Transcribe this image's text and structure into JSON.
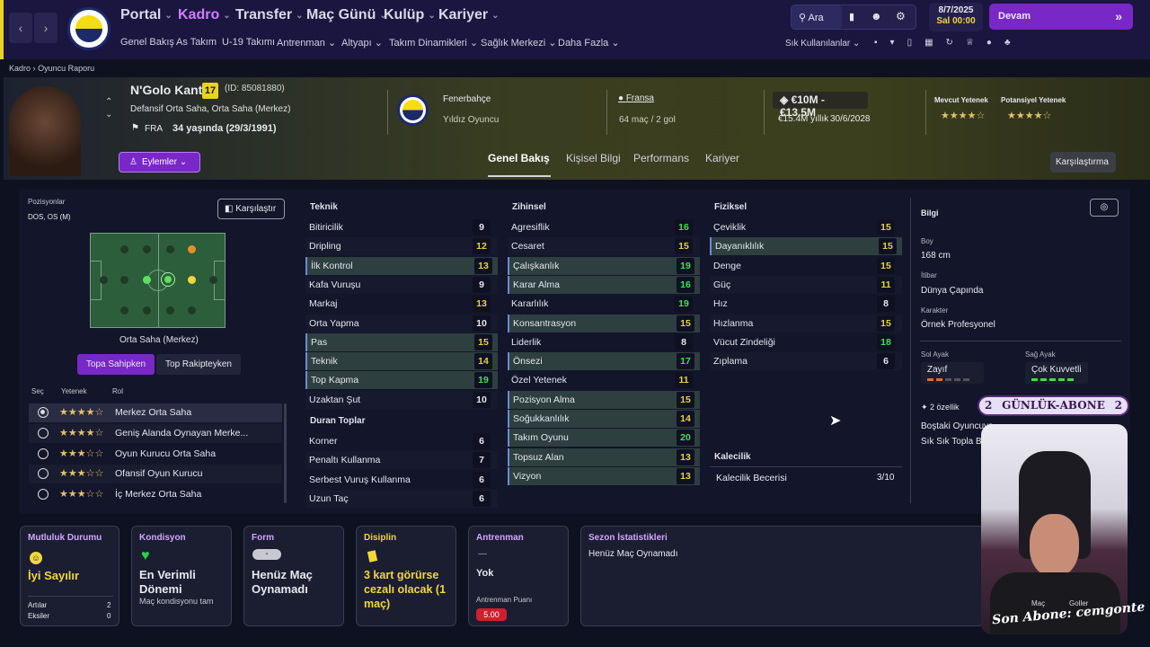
{
  "nav": {
    "back": "‹",
    "forward": "›",
    "main": [
      {
        "label": "Portal",
        "active": false
      },
      {
        "label": "Kadro",
        "active": true
      },
      {
        "label": "Transfer",
        "active": false
      },
      {
        "label": "Maç Günü",
        "active": false
      },
      {
        "label": "Kulüp",
        "active": false
      },
      {
        "label": "Kariyer",
        "active": false
      }
    ],
    "sub": [
      "Genel Bakış",
      "As Takım",
      "U-19 Takımı",
      "Antrenman",
      "Altyapı",
      "Takım Dinamikleri",
      "Sağlık Merkezi",
      "Daha Fazla"
    ],
    "search_label": "Ara",
    "date": "8/7/2025",
    "day_time": "Sal 00:00",
    "continue_label": "Devam",
    "frequent_label": "Sık Kullanılanlar"
  },
  "breadcrumb": [
    "Kadro",
    "Oyuncu Raporu"
  ],
  "player": {
    "name": "N'Golo Kanté",
    "number": "17",
    "id": "(ID: 85081880)",
    "positions": "Defansif Orta Saha, Orta Saha (Merkez)",
    "nation": "FRA",
    "age": "34 yaşında (29/3/1991)",
    "actions_label": "Eylemler",
    "club": "Fenerbahçe",
    "status": "Yıldız Oyuncu",
    "nation_full": "Fransa",
    "caps": "64 maç / 2 gol",
    "value": "€10M - €13.5M",
    "wage": "€15.4M yıllık",
    "contract": "30/6/2028",
    "current_ability_label": "Mevcut Yetenek",
    "potential_ability_label": "Potansiyel Yetenek",
    "current_ability_stars": "★★★★☆",
    "potential_ability_stars": "★★★★☆"
  },
  "tabs": [
    {
      "label": "Genel Bakış",
      "active": true
    },
    {
      "label": "Kişisel Bilgi",
      "active": false
    },
    {
      "label": "Performans",
      "active": false
    },
    {
      "label": "Kariyer",
      "active": false
    }
  ],
  "compare_label": "Karşılaştırma",
  "positions_panel": {
    "title": "Pozisyonlar",
    "value": "DOS, OS (M)",
    "compare_button": "Karşılaştır",
    "pitch_caption": "Orta Saha (Merkez)",
    "toggle_on": "Topa Sahipken",
    "toggle_off": "Top Rakipteyken",
    "columns": [
      "Seç",
      "Yetenek",
      "Rol"
    ],
    "roles": [
      {
        "stars": "★★★★☆",
        "role": "Merkez Orta Saha",
        "selected": true
      },
      {
        "stars": "★★★★☆",
        "role": "Geniş Alanda Oynayan Merke...",
        "selected": false
      },
      {
        "stars": "★★★☆☆",
        "role": "Oyun Kurucu Orta Saha",
        "selected": false
      },
      {
        "stars": "★★★☆☆",
        "role": "Ofansif Oyun Kurucu",
        "selected": false
      },
      {
        "stars": "★★★☆☆",
        "role": "İç Merkez Orta Saha",
        "selected": false
      }
    ]
  },
  "attributes": {
    "technical_title": "Teknik",
    "technical": [
      {
        "name": "Bitiricilik",
        "value": "9",
        "hl": false
      },
      {
        "name": "Dripling",
        "value": "12",
        "hl": false
      },
      {
        "name": "İlk Kontrol",
        "value": "13",
        "hl": true
      },
      {
        "name": "Kafa Vuruşu",
        "value": "9",
        "hl": false
      },
      {
        "name": "Markaj",
        "value": "13",
        "hl": false
      },
      {
        "name": "Orta Yapma",
        "value": "10",
        "hl": false
      },
      {
        "name": "Pas",
        "value": "15",
        "hl": true
      },
      {
        "name": "Teknik",
        "value": "14",
        "hl": true
      },
      {
        "name": "Top Kapma",
        "value": "19",
        "hl": true
      },
      {
        "name": "Uzaktan Şut",
        "value": "10",
        "hl": false
      }
    ],
    "set_pieces_title": "Duran Toplar",
    "set_pieces": [
      {
        "name": "Korner",
        "value": "6",
        "hl": false
      },
      {
        "name": "Penaltı Kullanma",
        "value": "7",
        "hl": false
      },
      {
        "name": "Serbest Vuruş Kullanma",
        "value": "6",
        "hl": false
      },
      {
        "name": "Uzun Taç",
        "value": "6",
        "hl": false
      }
    ],
    "mental_title": "Zihinsel",
    "mental": [
      {
        "name": "Agresiflik",
        "value": "16",
        "hl": false
      },
      {
        "name": "Cesaret",
        "value": "15",
        "hl": false
      },
      {
        "name": "Çalışkanlık",
        "value": "19",
        "hl": true
      },
      {
        "name": "Karar Alma",
        "value": "16",
        "hl": true
      },
      {
        "name": "Kararlılık",
        "value": "19",
        "hl": false
      },
      {
        "name": "Konsantrasyon",
        "value": "15",
        "hl": true
      },
      {
        "name": "Liderlik",
        "value": "8",
        "hl": false
      },
      {
        "name": "Önsezi",
        "value": "17",
        "hl": true
      },
      {
        "name": "Özel Yetenek",
        "value": "11",
        "hl": false
      },
      {
        "name": "Pozisyon Alma",
        "value": "15",
        "hl": true
      },
      {
        "name": "Soğukkanlılık",
        "value": "14",
        "hl": true
      },
      {
        "name": "Takım Oyunu",
        "value": "20",
        "hl": true
      },
      {
        "name": "Topsuz Alan",
        "value": "13",
        "hl": true
      },
      {
        "name": "Vizyon",
        "value": "13",
        "hl": true
      }
    ],
    "physical_title": "Fiziksel",
    "physical": [
      {
        "name": "Çeviklik",
        "value": "15",
        "hl": false
      },
      {
        "name": "Dayanıklılık",
        "value": "15",
        "hl": true
      },
      {
        "name": "Denge",
        "value": "15",
        "hl": false
      },
      {
        "name": "Güç",
        "value": "11",
        "hl": false
      },
      {
        "name": "Hız",
        "value": "8",
        "hl": false
      },
      {
        "name": "Hızlanma",
        "value": "15",
        "hl": false
      },
      {
        "name": "Vücut Zindeliği",
        "value": "18",
        "hl": false
      },
      {
        "name": "Zıplama",
        "value": "6",
        "hl": false
      }
    ],
    "goalkeeping_title": "Kalecilik",
    "goalkeeping_label": "Kalecilik Becerisi",
    "goalkeeping_value": "3/10"
  },
  "info": {
    "title": "Bilgi",
    "height_label": "Boy",
    "height": "168 cm",
    "rep_label": "İtibar",
    "rep": "Dünya Çapında",
    "char_label": "Karakter",
    "char": "Örnek Profesyonel",
    "left_foot_label": "Sol Ayak",
    "left_foot": "Zayıf",
    "right_foot_label": "Sağ Ayak",
    "right_foot": "Çok Kuvvetli",
    "traits": "2 özellik",
    "trait_text_1": "Boştaki Oyuncuya",
    "trait_text_2": "Sık Sık Topla Be"
  },
  "overlay": {
    "sub_banner": "GÜNLÜK-ABONE",
    "sub_num_left": "2",
    "sub_num_right": "2",
    "last_sub": "Son Abone: cemgonte",
    "stat_mac": "Maç",
    "stat_goller": "Goller"
  },
  "cards": {
    "happiness": {
      "title": "Mutluluk Durumu",
      "value": "İyi Sayılır",
      "plus_label": "Artılar",
      "plus": "2",
      "minus_label": "Eksiler",
      "minus": "0"
    },
    "condition": {
      "title": "Kondisyon",
      "value": "En Verimli Dönemi",
      "sub": "Maç kondisyonu tam"
    },
    "form": {
      "title": "Form",
      "badge": "-",
      "value": "Henüz Maç Oynamadı"
    },
    "discipline": {
      "title": "Disiplin",
      "value": "3 kart görürse cezalı olacak (1 maç)"
    },
    "training": {
      "title": "Antrenman",
      "dash": "—",
      "value": "Yok",
      "rating_label": "Antrenman Puanı",
      "rating": "5.00"
    },
    "season": {
      "title": "Sezon İstatistikleri",
      "value": "Henüz Maç Oynamadı"
    }
  },
  "colors": {
    "accent": "#7a27c8",
    "highlight_green": "#24d648",
    "topbar": "#1b1640"
  }
}
